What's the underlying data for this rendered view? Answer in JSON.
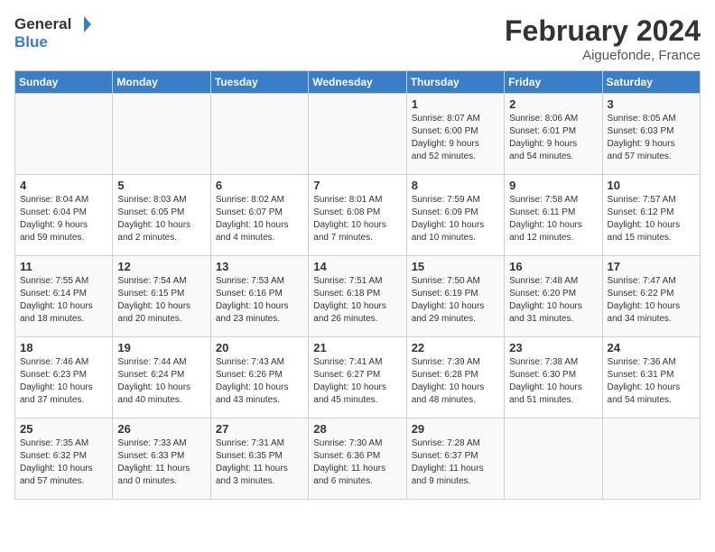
{
  "header": {
    "logo_general": "General",
    "logo_blue": "Blue",
    "month_year": "February 2024",
    "location": "Aiguefonde, France"
  },
  "weekdays": [
    "Sunday",
    "Monday",
    "Tuesday",
    "Wednesday",
    "Thursday",
    "Friday",
    "Saturday"
  ],
  "weeks": [
    [
      {
        "day": "",
        "info": ""
      },
      {
        "day": "",
        "info": ""
      },
      {
        "day": "",
        "info": ""
      },
      {
        "day": "",
        "info": ""
      },
      {
        "day": "1",
        "info": "Sunrise: 8:07 AM\nSunset: 6:00 PM\nDaylight: 9 hours\nand 52 minutes."
      },
      {
        "day": "2",
        "info": "Sunrise: 8:06 AM\nSunset: 6:01 PM\nDaylight: 9 hours\nand 54 minutes."
      },
      {
        "day": "3",
        "info": "Sunrise: 8:05 AM\nSunset: 6:03 PM\nDaylight: 9 hours\nand 57 minutes."
      }
    ],
    [
      {
        "day": "4",
        "info": "Sunrise: 8:04 AM\nSunset: 6:04 PM\nDaylight: 9 hours\nand 59 minutes."
      },
      {
        "day": "5",
        "info": "Sunrise: 8:03 AM\nSunset: 6:05 PM\nDaylight: 10 hours\nand 2 minutes."
      },
      {
        "day": "6",
        "info": "Sunrise: 8:02 AM\nSunset: 6:07 PM\nDaylight: 10 hours\nand 4 minutes."
      },
      {
        "day": "7",
        "info": "Sunrise: 8:01 AM\nSunset: 6:08 PM\nDaylight: 10 hours\nand 7 minutes."
      },
      {
        "day": "8",
        "info": "Sunrise: 7:59 AM\nSunset: 6:09 PM\nDaylight: 10 hours\nand 10 minutes."
      },
      {
        "day": "9",
        "info": "Sunrise: 7:58 AM\nSunset: 6:11 PM\nDaylight: 10 hours\nand 12 minutes."
      },
      {
        "day": "10",
        "info": "Sunrise: 7:57 AM\nSunset: 6:12 PM\nDaylight: 10 hours\nand 15 minutes."
      }
    ],
    [
      {
        "day": "11",
        "info": "Sunrise: 7:55 AM\nSunset: 6:14 PM\nDaylight: 10 hours\nand 18 minutes."
      },
      {
        "day": "12",
        "info": "Sunrise: 7:54 AM\nSunset: 6:15 PM\nDaylight: 10 hours\nand 20 minutes."
      },
      {
        "day": "13",
        "info": "Sunrise: 7:53 AM\nSunset: 6:16 PM\nDaylight: 10 hours\nand 23 minutes."
      },
      {
        "day": "14",
        "info": "Sunrise: 7:51 AM\nSunset: 6:18 PM\nDaylight: 10 hours\nand 26 minutes."
      },
      {
        "day": "15",
        "info": "Sunrise: 7:50 AM\nSunset: 6:19 PM\nDaylight: 10 hours\nand 29 minutes."
      },
      {
        "day": "16",
        "info": "Sunrise: 7:48 AM\nSunset: 6:20 PM\nDaylight: 10 hours\nand 31 minutes."
      },
      {
        "day": "17",
        "info": "Sunrise: 7:47 AM\nSunset: 6:22 PM\nDaylight: 10 hours\nand 34 minutes."
      }
    ],
    [
      {
        "day": "18",
        "info": "Sunrise: 7:46 AM\nSunset: 6:23 PM\nDaylight: 10 hours\nand 37 minutes."
      },
      {
        "day": "19",
        "info": "Sunrise: 7:44 AM\nSunset: 6:24 PM\nDaylight: 10 hours\nand 40 minutes."
      },
      {
        "day": "20",
        "info": "Sunrise: 7:43 AM\nSunset: 6:26 PM\nDaylight: 10 hours\nand 43 minutes."
      },
      {
        "day": "21",
        "info": "Sunrise: 7:41 AM\nSunset: 6:27 PM\nDaylight: 10 hours\nand 45 minutes."
      },
      {
        "day": "22",
        "info": "Sunrise: 7:39 AM\nSunset: 6:28 PM\nDaylight: 10 hours\nand 48 minutes."
      },
      {
        "day": "23",
        "info": "Sunrise: 7:38 AM\nSunset: 6:30 PM\nDaylight: 10 hours\nand 51 minutes."
      },
      {
        "day": "24",
        "info": "Sunrise: 7:36 AM\nSunset: 6:31 PM\nDaylight: 10 hours\nand 54 minutes."
      }
    ],
    [
      {
        "day": "25",
        "info": "Sunrise: 7:35 AM\nSunset: 6:32 PM\nDaylight: 10 hours\nand 57 minutes."
      },
      {
        "day": "26",
        "info": "Sunrise: 7:33 AM\nSunset: 6:33 PM\nDaylight: 11 hours\nand 0 minutes."
      },
      {
        "day": "27",
        "info": "Sunrise: 7:31 AM\nSunset: 6:35 PM\nDaylight: 11 hours\nand 3 minutes."
      },
      {
        "day": "28",
        "info": "Sunrise: 7:30 AM\nSunset: 6:36 PM\nDaylight: 11 hours\nand 6 minutes."
      },
      {
        "day": "29",
        "info": "Sunrise: 7:28 AM\nSunset: 6:37 PM\nDaylight: 11 hours\nand 9 minutes."
      },
      {
        "day": "",
        "info": ""
      },
      {
        "day": "",
        "info": ""
      }
    ]
  ]
}
